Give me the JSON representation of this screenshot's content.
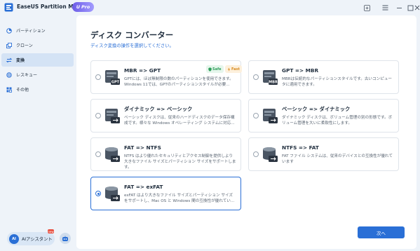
{
  "app": {
    "title": "EaseUS Partition Master",
    "badge": "Pro",
    "badge_letter": "U"
  },
  "sidebar": {
    "items": [
      {
        "label": "パーティション",
        "icon": "partition-icon",
        "active": false
      },
      {
        "label": "クローン",
        "icon": "clone-icon",
        "active": false
      },
      {
        "label": "変換",
        "icon": "convert-icon",
        "active": true
      },
      {
        "label": "レスキュー",
        "icon": "rescue-icon",
        "active": false
      },
      {
        "label": "その他",
        "icon": "more-icon",
        "active": false
      }
    ],
    "ai_assistant": "AIアシスタント",
    "ai_avatar": "AI",
    "new_badge": "new"
  },
  "main": {
    "title": "ディスク コンバーター",
    "subtitle": "ディスク変換の操作を選択してください。",
    "options": [
      {
        "title": "MBR => GPT",
        "desc": "GPTには、ほぼ無制限の数のパーティションを使用できます。Windows 11では、GPTのパーティションスタイルが必要...",
        "tags": [
          "Safe",
          "Fast"
        ],
        "selected": false
      },
      {
        "title": "GPT => MBR",
        "desc": "MBRは伝統的なパーティションスタイルです。古いコンピュータに適用できます。",
        "selected": false
      },
      {
        "title": "ダイナミック => ベーシック",
        "desc": "ベーシック ディスクは、従来のハードディスクのデータ保存構成です。様々な Windows オペレーティング システムに対応...",
        "selected": false
      },
      {
        "title": "ベーシック => ダイナミック",
        "desc": "ダイナミック ディスクは、ボリューム管理の別の形態です。ボリューム管理を大いに柔軟性にします。",
        "selected": false
      },
      {
        "title": "FAT => NTFS",
        "desc": "NTFS はより優れたセキュリティとアクセス制御を提供しより大きなファイル サイズとパーティション サイズをサポートします。",
        "selected": false
      },
      {
        "title": "NTFS => FAT",
        "desc": "FAT ファイル システムは、従来のデバイスとの互換性が優れています",
        "selected": false
      },
      {
        "title": "FAT => exFAT",
        "desc": "exFAT はより大きなファイル サイズとパーティション サイズをサポートし、Mac OS と Windows 間の互換性が優れてい...",
        "selected": true
      }
    ],
    "next_button": "次へ"
  },
  "colors": {
    "accent": "#2a6fd6",
    "safe": "#2e9e5b",
    "fast": "#d88a1e",
    "background": "#eef3f9"
  }
}
